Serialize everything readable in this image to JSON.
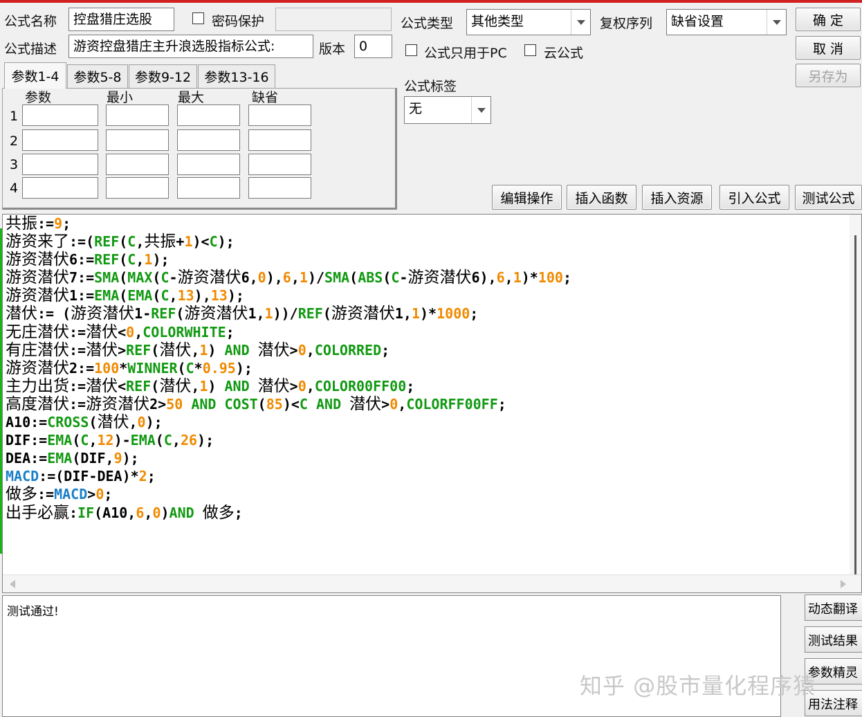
{
  "form": {
    "name_label": "公式名称",
    "name_value": "控盘猎庄选股",
    "password_label": "密码保护",
    "password_value": "",
    "desc_label": "公式描述",
    "desc_value": "游资控盘猎庄主升浪选股指标公式:",
    "version_label": "版本",
    "version_value": "0",
    "type_label": "公式类型",
    "type_value": "其他类型",
    "restore_label": "复权序列",
    "restore_value": "缺省设置",
    "pc_only_label": "公式只用于PC",
    "cloud_label": "云公式",
    "tag_label": "公式标签",
    "tag_value": "无"
  },
  "right_buttons": {
    "ok": "确 定",
    "cancel": "取 消",
    "save_as": "另存为"
  },
  "tabs": [
    "参数1-4",
    "参数5-8",
    "参数9-12",
    "参数13-16"
  ],
  "param_headers": [
    "参数",
    "最小",
    "最大",
    "缺省"
  ],
  "param_rows": [
    "1",
    "2",
    "3",
    "4"
  ],
  "toolbar": [
    "编辑操作",
    "插入函数",
    "插入资源",
    "引入公式",
    "测试公式"
  ],
  "colors": {
    "keyword": "#119911",
    "number": "#f08a00",
    "blue": "#1a7fc7",
    "text": "#000000"
  },
  "code_lines": [
    [
      [
        "共振",
        "cn",
        "t"
      ],
      [
        ":=",
        "",
        "t"
      ],
      [
        "9",
        "",
        "n"
      ],
      [
        ";",
        "",
        "t"
      ]
    ],
    [
      [
        "游资来了",
        "cn",
        "t"
      ],
      [
        ":=(",
        "",
        "t"
      ],
      [
        "REF",
        "",
        "k"
      ],
      [
        "(",
        "",
        "t"
      ],
      [
        "C",
        "",
        "k"
      ],
      [
        ",",
        "",
        "t"
      ],
      [
        "共振",
        "cn",
        "t"
      ],
      [
        "+",
        "",
        "t"
      ],
      [
        "1",
        "",
        "n"
      ],
      [
        ")<",
        "",
        "t"
      ],
      [
        "C",
        "",
        "k"
      ],
      [
        ");",
        "",
        "t"
      ]
    ],
    [
      [
        "游资潜伏",
        "cn",
        "t"
      ],
      [
        "6:=",
        "",
        "t"
      ],
      [
        "REF",
        "",
        "k"
      ],
      [
        "(",
        "",
        "t"
      ],
      [
        "C",
        "",
        "k"
      ],
      [
        ",",
        "",
        "t"
      ],
      [
        "1",
        "",
        "n"
      ],
      [
        ");",
        "",
        "t"
      ]
    ],
    [
      [
        "游资潜伏",
        "cn",
        "t"
      ],
      [
        "7:=",
        "",
        "t"
      ],
      [
        "SMA",
        "",
        "k"
      ],
      [
        "(",
        "",
        "t"
      ],
      [
        "MAX",
        "",
        "k"
      ],
      [
        "(",
        "",
        "t"
      ],
      [
        "C",
        "",
        "k"
      ],
      [
        "-",
        "",
        "t"
      ],
      [
        "游资潜伏",
        "cn",
        "t"
      ],
      [
        "6,",
        "",
        "t"
      ],
      [
        "0",
        "",
        "n"
      ],
      [
        "),",
        "",
        "t"
      ],
      [
        "6",
        "",
        "n"
      ],
      [
        ",",
        "",
        "t"
      ],
      [
        "1",
        "",
        "n"
      ],
      [
        ")/",
        "",
        "t"
      ],
      [
        "SMA",
        "",
        "k"
      ],
      [
        "(",
        "",
        "t"
      ],
      [
        "ABS",
        "",
        "k"
      ],
      [
        "(",
        "",
        "t"
      ],
      [
        "C",
        "",
        "k"
      ],
      [
        "-",
        "",
        "t"
      ],
      [
        "游资潜伏",
        "cn",
        "t"
      ],
      [
        "6),",
        "",
        "t"
      ],
      [
        "6",
        "",
        "n"
      ],
      [
        ",",
        "",
        "t"
      ],
      [
        "1",
        "",
        "n"
      ],
      [
        ")*",
        "",
        "t"
      ],
      [
        "100",
        "",
        "n"
      ],
      [
        ";",
        "",
        "t"
      ]
    ],
    [
      [
        "游资潜伏",
        "cn",
        "t"
      ],
      [
        "1:=",
        "",
        "t"
      ],
      [
        "EMA",
        "",
        "k"
      ],
      [
        "(",
        "",
        "t"
      ],
      [
        "EMA",
        "",
        "k"
      ],
      [
        "(",
        "",
        "t"
      ],
      [
        "C",
        "",
        "k"
      ],
      [
        ",",
        "",
        "t"
      ],
      [
        "13",
        "",
        "n"
      ],
      [
        "),",
        "",
        "t"
      ],
      [
        "13",
        "",
        "n"
      ],
      [
        ");",
        "",
        "t"
      ]
    ],
    [
      [
        "潜伏",
        "cn",
        "t"
      ],
      [
        ":= (",
        "",
        "t"
      ],
      [
        "游资潜伏",
        "cn",
        "t"
      ],
      [
        "1-",
        "",
        "t"
      ],
      [
        "REF",
        "",
        "k"
      ],
      [
        "(",
        "",
        "t"
      ],
      [
        "游资潜伏",
        "cn",
        "t"
      ],
      [
        "1,",
        "",
        "t"
      ],
      [
        "1",
        "",
        "n"
      ],
      [
        "))/",
        "",
        "t"
      ],
      [
        "REF",
        "",
        "k"
      ],
      [
        "(",
        "",
        "t"
      ],
      [
        "游资潜伏",
        "cn",
        "t"
      ],
      [
        "1,",
        "",
        "t"
      ],
      [
        "1",
        "",
        "n"
      ],
      [
        ")*",
        "",
        "t"
      ],
      [
        "1000",
        "",
        "n"
      ],
      [
        ";",
        "",
        "t"
      ]
    ],
    [
      [
        "无庄潜伏",
        "cn",
        "t"
      ],
      [
        ":=",
        "",
        "t"
      ],
      [
        "潜伏",
        "cn",
        "t"
      ],
      [
        "<",
        "",
        "t"
      ],
      [
        "0",
        "",
        "n"
      ],
      [
        ",",
        "",
        "t"
      ],
      [
        "COLORWHITE",
        "",
        "k"
      ],
      [
        ";",
        "",
        "t"
      ]
    ],
    [
      [
        "有庄潜伏",
        "cn",
        "t"
      ],
      [
        ":=",
        "",
        "t"
      ],
      [
        "潜伏",
        "cn",
        "t"
      ],
      [
        ">",
        "",
        "t"
      ],
      [
        "REF",
        "",
        "k"
      ],
      [
        "(",
        "",
        "t"
      ],
      [
        "潜伏",
        "cn",
        "t"
      ],
      [
        ",",
        "",
        "t"
      ],
      [
        "1",
        "",
        "n"
      ],
      [
        ") ",
        "",
        "t"
      ],
      [
        "AND",
        "",
        "k"
      ],
      [
        " ",
        "",
        "t"
      ],
      [
        "潜伏",
        "cn",
        "t"
      ],
      [
        ">",
        "",
        "t"
      ],
      [
        "0",
        "",
        "n"
      ],
      [
        ",",
        "",
        "t"
      ],
      [
        "COLORRED",
        "",
        "k"
      ],
      [
        ";",
        "",
        "t"
      ]
    ],
    [
      [
        "游资潜伏",
        "cn",
        "t"
      ],
      [
        "2:=",
        "",
        "t"
      ],
      [
        "100",
        "",
        "n"
      ],
      [
        "*",
        "",
        "t"
      ],
      [
        "WINNER",
        "",
        "k"
      ],
      [
        "(",
        "",
        "t"
      ],
      [
        "C",
        "",
        "k"
      ],
      [
        "*",
        "",
        "t"
      ],
      [
        "0.95",
        "",
        "n"
      ],
      [
        ");",
        "",
        "t"
      ]
    ],
    [
      [
        "主力出货",
        "cn",
        "t"
      ],
      [
        ":=",
        "",
        "t"
      ],
      [
        "潜伏",
        "cn",
        "t"
      ],
      [
        "<",
        "",
        "t"
      ],
      [
        "REF",
        "",
        "k"
      ],
      [
        "(",
        "",
        "t"
      ],
      [
        "潜伏",
        "cn",
        "t"
      ],
      [
        ",",
        "",
        "t"
      ],
      [
        "1",
        "",
        "n"
      ],
      [
        ") ",
        "",
        "t"
      ],
      [
        "AND",
        "",
        "k"
      ],
      [
        " ",
        "",
        "t"
      ],
      [
        "潜伏",
        "cn",
        "t"
      ],
      [
        ">",
        "",
        "t"
      ],
      [
        "0",
        "",
        "n"
      ],
      [
        ",",
        "",
        "t"
      ],
      [
        "COLOR00FF00",
        "",
        "k"
      ],
      [
        ";",
        "",
        "t"
      ]
    ],
    [
      [
        "高度潜伏",
        "cn",
        "t"
      ],
      [
        ":=",
        "",
        "t"
      ],
      [
        "游资潜伏",
        "cn",
        "t"
      ],
      [
        "2>",
        "",
        "t"
      ],
      [
        "50",
        "",
        "n"
      ],
      [
        " ",
        "",
        "t"
      ],
      [
        "AND",
        "",
        "k"
      ],
      [
        " ",
        "",
        "t"
      ],
      [
        "COST",
        "",
        "k"
      ],
      [
        "(",
        "",
        "t"
      ],
      [
        "85",
        "",
        "n"
      ],
      [
        ")<",
        "",
        "t"
      ],
      [
        "C",
        "",
        "k"
      ],
      [
        " ",
        "",
        "t"
      ],
      [
        "AND",
        "",
        "k"
      ],
      [
        " ",
        "",
        "t"
      ],
      [
        "潜伏",
        "cn",
        "t"
      ],
      [
        ">",
        "",
        "t"
      ],
      [
        "0",
        "",
        "n"
      ],
      [
        ",",
        "",
        "t"
      ],
      [
        "COLORFF00FF",
        "",
        "k"
      ],
      [
        ";",
        "",
        "t"
      ]
    ],
    [
      [
        "A10:=",
        "",
        "t"
      ],
      [
        "CROSS",
        "",
        "k"
      ],
      [
        "(",
        "",
        "t"
      ],
      [
        "潜伏",
        "cn",
        "t"
      ],
      [
        ",",
        "",
        "t"
      ],
      [
        "0",
        "",
        "n"
      ],
      [
        ");",
        "",
        "t"
      ]
    ],
    [
      [
        "DIF:=",
        "",
        "t"
      ],
      [
        "EMA",
        "",
        "k"
      ],
      [
        "(",
        "",
        "t"
      ],
      [
        "C",
        "",
        "k"
      ],
      [
        ",",
        "",
        "t"
      ],
      [
        "12",
        "",
        "n"
      ],
      [
        ")-",
        "",
        "t"
      ],
      [
        "EMA",
        "",
        "k"
      ],
      [
        "(",
        "",
        "t"
      ],
      [
        "C",
        "",
        "k"
      ],
      [
        ",",
        "",
        "t"
      ],
      [
        "26",
        "",
        "n"
      ],
      [
        ");",
        "",
        "t"
      ]
    ],
    [
      [
        "DEA:=",
        "",
        "t"
      ],
      [
        "EMA",
        "",
        "k"
      ],
      [
        "(DIF,",
        "",
        "t"
      ],
      [
        "9",
        "",
        "n"
      ],
      [
        ");",
        "",
        "t"
      ]
    ],
    [
      [
        "MACD",
        "",
        "b"
      ],
      [
        ":=(DIF-DEA)*",
        "",
        "t"
      ],
      [
        "2",
        "",
        "n"
      ],
      [
        ";",
        "",
        "t"
      ]
    ],
    [
      [
        "做多",
        "cn",
        "t"
      ],
      [
        ":=",
        "",
        "t"
      ],
      [
        "MACD",
        "",
        "b"
      ],
      [
        ">",
        "",
        "t"
      ],
      [
        "0",
        "",
        "n"
      ],
      [
        ";",
        "",
        "t"
      ]
    ],
    [
      [
        "出手必赢",
        "cn",
        "t"
      ],
      [
        ":",
        "",
        "t"
      ],
      [
        "IF",
        "",
        "k"
      ],
      [
        "(A10,",
        "",
        "t"
      ],
      [
        "6",
        "",
        "n"
      ],
      [
        ",",
        "",
        "t"
      ],
      [
        "0",
        "",
        "n"
      ],
      [
        ")",
        "",
        "t"
      ],
      [
        "AND",
        "",
        "k"
      ],
      [
        " ",
        "",
        "t"
      ],
      [
        "做多",
        "cn",
        "t"
      ],
      [
        ";",
        "",
        "t"
      ]
    ]
  ],
  "output_text": "测试通过!",
  "side_buttons": [
    "动态翻译",
    "测试结果",
    "参数精灵",
    "用法注释"
  ],
  "watermark": "知乎 @股市量化程序猿"
}
